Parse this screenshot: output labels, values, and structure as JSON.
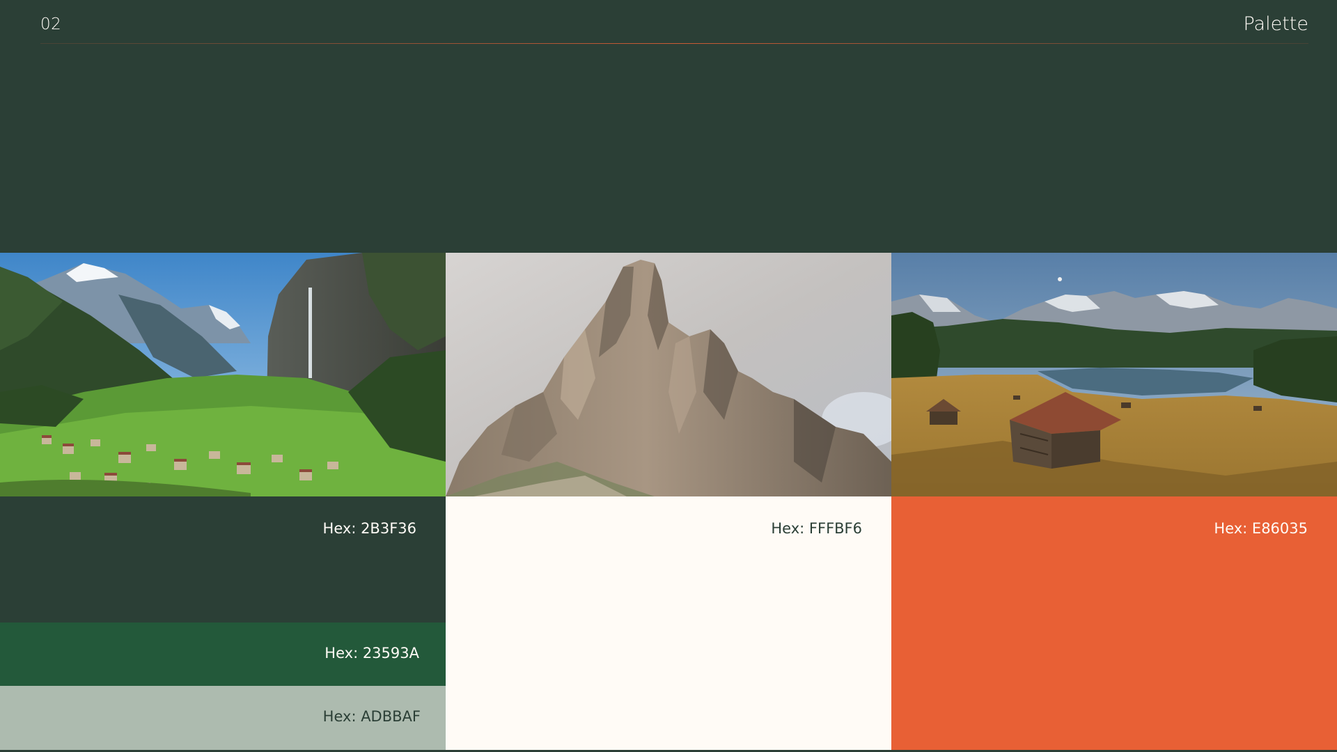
{
  "header": {
    "page_number": "02",
    "title": "Palette"
  },
  "palette": {
    "dark_green": {
      "label": "Hex: 2B3F36",
      "color": "#2B3F36"
    },
    "forest_green": {
      "label": "Hex: 23593A",
      "color": "#23593A"
    },
    "sage": {
      "label": "Hex: ADBBAF",
      "color": "#ADBBAF"
    },
    "cream": {
      "label": "Hex: FFFBF6",
      "color": "#FFFBF6"
    },
    "orange": {
      "label": "Hex: E86035",
      "color": "#E86035"
    }
  },
  "accent_color": "#E86035"
}
